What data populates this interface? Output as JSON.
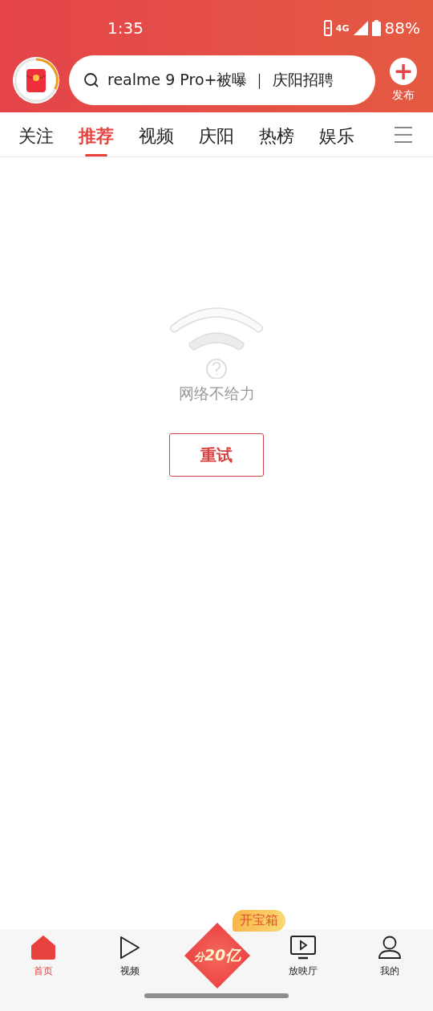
{
  "status_bar": {
    "time": "1:35",
    "network": "4G",
    "battery": "88%"
  },
  "header": {
    "search": {
      "value": "realme 9 Pro+被曝 ｜ 庆阳招聘"
    },
    "publish": {
      "icon": "+",
      "label": "发布"
    }
  },
  "tabs": [
    {
      "label": "关注",
      "selected": false
    },
    {
      "label": "推荐",
      "selected": true
    },
    {
      "label": "视频",
      "selected": false
    },
    {
      "label": "庆阳",
      "selected": false
    },
    {
      "label": "热榜",
      "selected": false
    },
    {
      "label": "娱乐",
      "selected": false
    }
  ],
  "error": {
    "message": "网络不给力",
    "retry": "重试"
  },
  "bottom_nav": [
    {
      "kind": "home",
      "label": "首页",
      "selected": true
    },
    {
      "kind": "video",
      "label": "视频",
      "selected": false
    },
    {
      "kind": "promo",
      "prefix": "分",
      "amount": "20亿",
      "tag": "开宝箱"
    },
    {
      "kind": "tv",
      "label": "放映厅",
      "selected": false
    },
    {
      "kind": "me",
      "label": "我的",
      "selected": false
    }
  ]
}
